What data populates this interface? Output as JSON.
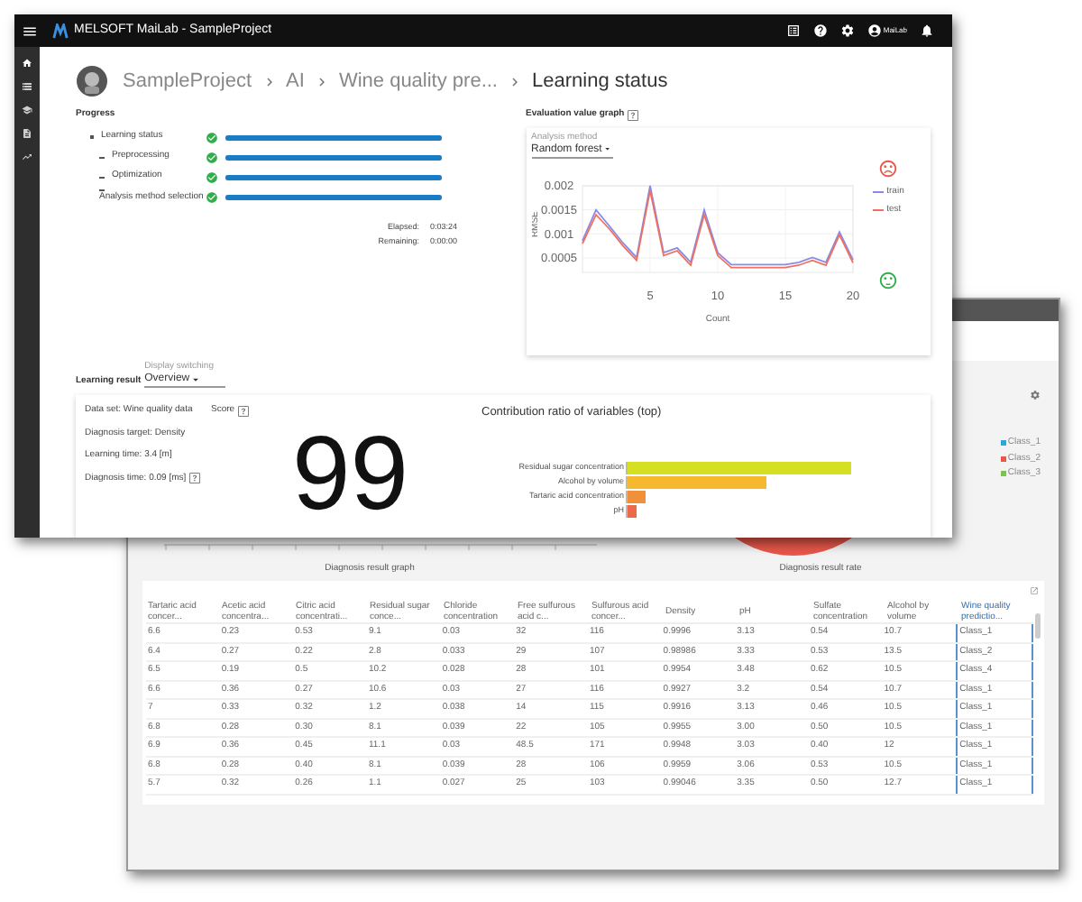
{
  "app_bar": {
    "title": "MELSOFT MaiLab - SampleProject",
    "user": "MaiLab"
  },
  "breadcrumb": [
    "SampleProject",
    "AI",
    "Wine quality pre...",
    "Learning status"
  ],
  "progress": {
    "title": "Progress",
    "items": [
      {
        "label": "Learning status",
        "done": true,
        "level": 1,
        "children": [
          {
            "label": "Preprocessing",
            "done": true,
            "level": 1
          },
          {
            "label": "Optimization",
            "done": true,
            "level": 1
          },
          {
            "label": "Analysis method selection",
            "done": true,
            "level": 1
          }
        ]
      }
    ],
    "elapsed_label": "Elapsed:",
    "elapsed": "0:03:24",
    "remaining_label": "Remaining:",
    "remaining": "0:00:00"
  },
  "evaluation": {
    "title": "Evaluation value graph",
    "method_label": "Analysis method",
    "method": "Random forest",
    "chart_data": {
      "type": "line",
      "xlabel": "Count",
      "ylabel": "RMSE",
      "x": [
        0,
        1,
        2,
        3,
        4,
        5,
        6,
        7,
        8,
        9,
        10,
        11,
        12,
        13,
        14,
        15,
        16,
        17,
        18,
        19,
        20
      ],
      "series": [
        {
          "name": "train",
          "color": "#8a8ae6",
          "values": [
            0.00086,
            0.0015,
            0.00116,
            0.00081,
            0.00051,
            0.002,
            0.00061,
            0.00071,
            0.00041,
            0.0015,
            0.00061,
            0.00036,
            0.00036,
            0.00036,
            0.00036,
            0.00036,
            0.00041,
            0.00051,
            0.00041,
            0.00104,
            0.00046
          ]
        },
        {
          "name": "test",
          "color": "#f07060",
          "values": [
            0.0008,
            0.0014,
            0.0011,
            0.00075,
            0.00045,
            0.0019,
            0.00055,
            0.00065,
            0.00035,
            0.0014,
            0.00055,
            0.0003,
            0.0003,
            0.0003,
            0.0003,
            0.0003,
            0.00035,
            0.00045,
            0.00035,
            0.00098,
            0.0004
          ]
        }
      ],
      "grid": true,
      "xlim": [
        0,
        20
      ],
      "ylim": [
        0.0002,
        0.002
      ],
      "xticks": [
        5,
        10,
        15,
        20
      ],
      "yticks": [
        0.0005,
        0.001,
        0.0015,
        0.002
      ]
    }
  },
  "learning_result": {
    "title": "Learning result",
    "display_label": "Display switching",
    "display": "Overview",
    "facts": [
      {
        "text": "Data set: Wine quality data",
        "help": false
      },
      {
        "text": "Diagnosis target: Density",
        "help": false
      },
      {
        "text": "Learning time: 3.4 [m]",
        "help": false
      },
      {
        "text": "Diagnosis time: 0.09 [ms]",
        "help": true
      }
    ],
    "score_label": "Score",
    "score": "99",
    "contribution": {
      "title": "Contribution ratio of variables (top)",
      "variables": [
        {
          "name": "Residual sugar concentration",
          "level": 1,
          "color": "#d4e021"
        },
        {
          "name": "Alcohol by volume",
          "level": 0.62,
          "color": "#f5b82e"
        },
        {
          "name": "Tartaric acid concentration",
          "level": 0.08,
          "color": "#f0903a"
        },
        {
          "name": "pH",
          "level": 0.04,
          "color": "#ec6a4a"
        }
      ]
    }
  },
  "diagnosis": {
    "graph_title": "Diagnosis result graph",
    "rate_title": "Diagnosis result rate",
    "legend": [
      {
        "label": "Class_1",
        "color": "#2aa7e0"
      },
      {
        "label": "Class_2",
        "color": "#e8574a"
      },
      {
        "label": "Class_3",
        "color": "#7cc44e"
      }
    ],
    "table": {
      "columns": [
        {
          "label": "Tartaric acid concer...",
          "selected": false
        },
        {
          "label": "Acetic acid concentra...",
          "selected": false
        },
        {
          "label": "Citric acid concentrati...",
          "selected": false
        },
        {
          "label": "Residual sugar conce...",
          "selected": false
        },
        {
          "label": "Chloride concentration",
          "selected": false
        },
        {
          "label": "Free sulfurous acid c...",
          "selected": false
        },
        {
          "label": "Sulfurous acid concer...",
          "selected": false
        },
        {
          "label": "Density",
          "selected": false
        },
        {
          "label": "pH",
          "selected": false
        },
        {
          "label": "Sulfate concentration",
          "selected": false
        },
        {
          "label": "Alcohol by volume",
          "selected": false
        },
        {
          "label": "Wine quality predictio...",
          "selected": true
        }
      ],
      "rows": [
        [
          "6.6",
          "0.23",
          "0.53",
          "9.1",
          "0.03",
          "32",
          "116",
          "0.9996",
          "3.13",
          "0.54",
          "10.7",
          "Class_1"
        ],
        [
          "6.4",
          "0.27",
          "0.22",
          "2.8",
          "0.033",
          "29",
          "107",
          "0.98986",
          "3.33",
          "0.53",
          "13.5",
          "Class_2"
        ],
        [
          "6.5",
          "0.19",
          "0.5",
          "10.2",
          "0.028",
          "28",
          "101",
          "0.9954",
          "3.48",
          "0.62",
          "10.5",
          "Class_4"
        ],
        [
          "6.6",
          "0.36",
          "0.27",
          "10.6",
          "0.03",
          "27",
          "116",
          "0.9927",
          "3.2",
          "0.54",
          "10.7",
          "Class_1"
        ],
        [
          "7",
          "0.33",
          "0.32",
          "1.2",
          "0.038",
          "14",
          "115",
          "0.9916",
          "3.13",
          "0.46",
          "10.5",
          "Class_1"
        ],
        [
          "6.8",
          "0.28",
          "0.30",
          "8.1",
          "0.039",
          "22",
          "105",
          "0.9955",
          "3.00",
          "0.50",
          "10.5",
          "Class_1"
        ],
        [
          "6.9",
          "0.36",
          "0.45",
          "11.1",
          "0.03",
          "48.5",
          "171",
          "0.9948",
          "3.03",
          "0.40",
          "12",
          "Class_1"
        ],
        [
          "6.8",
          "0.28",
          "0.40",
          "8.1",
          "0.039",
          "28",
          "106",
          "0.9959",
          "3.06",
          "0.53",
          "10.5",
          "Class_1"
        ],
        [
          "5.7",
          "0.32",
          "0.26",
          "1.1",
          "0.027",
          "25",
          "103",
          "0.99046",
          "3.35",
          "0.50",
          "12.7",
          "Class_1"
        ]
      ]
    }
  }
}
